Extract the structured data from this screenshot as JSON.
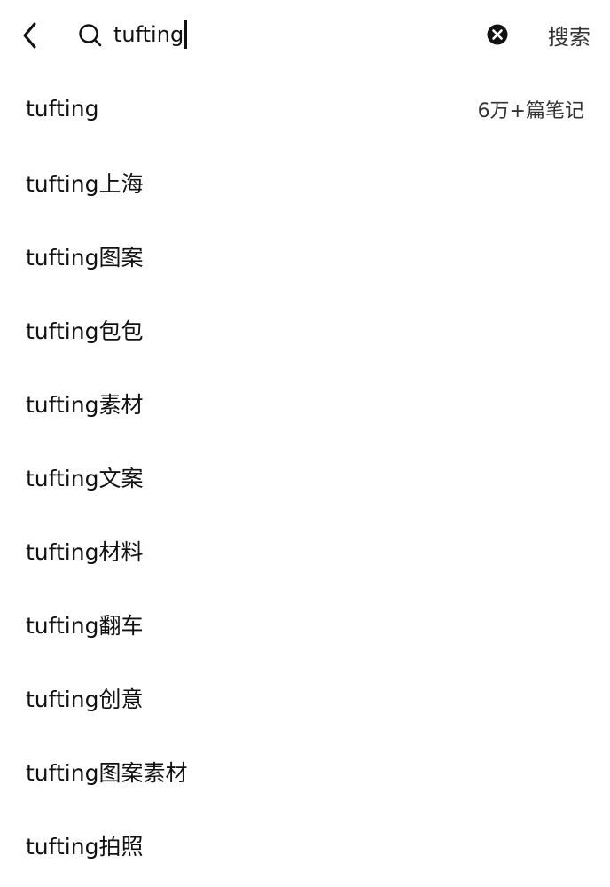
{
  "search": {
    "query": "tufting",
    "submit_label": "搜索"
  },
  "icons": {
    "back": "chevron-left-icon",
    "search": "search-icon",
    "clear": "clear-icon"
  },
  "suggestions": [
    {
      "text": "tufting",
      "count": "6万+篇笔记"
    },
    {
      "text": "tufting上海"
    },
    {
      "text": "tufting图案"
    },
    {
      "text": "tufting包包"
    },
    {
      "text": "tufting素材"
    },
    {
      "text": "tufting文案"
    },
    {
      "text": "tufting材料"
    },
    {
      "text": "tufting翻车"
    },
    {
      "text": "tufting创意"
    },
    {
      "text": "tufting图案素材"
    },
    {
      "text": "tufting拍照"
    }
  ]
}
